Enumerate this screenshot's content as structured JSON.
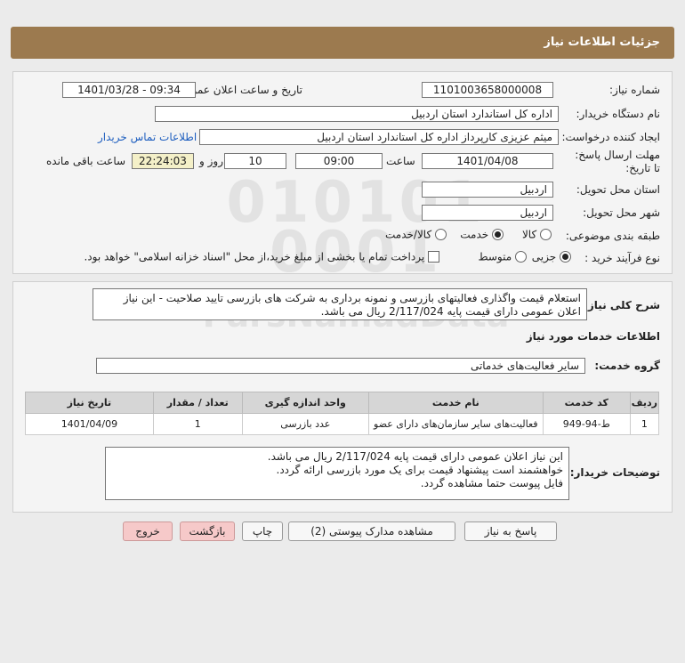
{
  "header": {
    "title": "جزئیات اطلاعات نیاز"
  },
  "fields": {
    "need_number_label": "شماره نیاز:",
    "need_number": "1101003658000008",
    "announce_label": "تاریخ و ساعت اعلان عمومی:",
    "announce_value": "1401/03/28 - 09:34",
    "buyer_org_label": "نام دستگاه خریدار:",
    "buyer_org": "اداره کل استاندارد استان اردبیل",
    "requester_label": "ایجاد کننده درخواست:",
    "requester": "میثم عزیزی کارپرداز اداره کل استاندارد استان اردبیل",
    "contact_link": "اطلاعات تماس خریدار",
    "deadline_label": "مهلت ارسال پاسخ: تا تاریخ:",
    "deadline_date": "1401/04/08",
    "time_label": "ساعت",
    "deadline_time": "09:00",
    "days": "10",
    "days_label": "روز و",
    "remaining": "22:24:03",
    "remaining_label": "ساعت باقی مانده",
    "province_label": "استان محل تحویل:",
    "province": "اردبیل",
    "city_label": "شهر محل تحویل:",
    "city": "اردبیل",
    "category_label": "طبقه بندی موضوعی:",
    "cat_goods": "کالا",
    "cat_service": "خدمت",
    "cat_goods_service": "کالا/خدمت",
    "process_label": "نوع فرآیند خرید :",
    "proc_partial": "جزیی",
    "proc_medium": "متوسط",
    "payment_note": "پرداخت تمام یا بخشی از مبلغ خرید،از محل \"اسناد خزانه اسلامی\" خواهد بود."
  },
  "description": {
    "label": "شرح کلی نیاز:",
    "text": "استعلام قیمت واگذاری فعالیتهای بازرسی و نمونه برداری به شرکت های بازرسی تایید صلاحیت - این نیاز اعلان عمومی دارای قیمت پایه 2/117/024 ریال می باشد."
  },
  "services": {
    "section_title": "اطلاعات خدمات مورد نیاز",
    "group_label": "گروه خدمت:",
    "group_value": "سایر فعالیت‌های خدماتی",
    "columns": [
      "ردیف",
      "کد خدمت",
      "نام خدمت",
      "واحد اندازه گیری",
      "تعداد / مقدار",
      "تاریخ نیاز"
    ],
    "rows": [
      [
        "1",
        "ط-94-949",
        "فعالیت‌های سایر سازمان‌های دارای عضو",
        "عدد بازرسی",
        "1",
        "1401/04/09"
      ]
    ]
  },
  "buyer_notes": {
    "label": "توضیحات خریدار:",
    "lines": [
      "این نیاز اعلان عمومی دارای قیمت پایه 2/117/024 ریال می باشد.",
      "خواهشمند است پیشنهاد قیمت برای یک مورد بازرسی ارائه گردد.",
      "فایل پیوست حتما مشاهده گردد."
    ]
  },
  "watermark": {
    "line1": "010101",
    "line2": "0001",
    "name": "ParsNamadData"
  },
  "buttons": {
    "reply": "پاسخ به نیاز",
    "attachments": "مشاهده مدارک پیوستی (2)",
    "print": "چاپ",
    "back": "بازگشت",
    "exit": "خروج"
  }
}
